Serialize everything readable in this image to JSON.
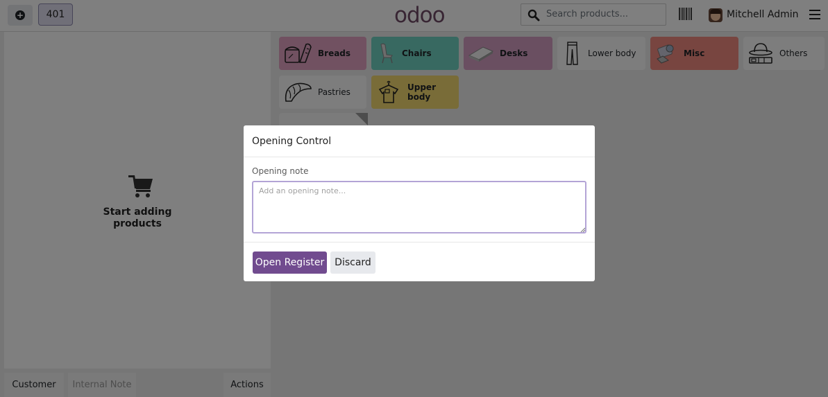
{
  "topbar": {
    "order_number": "401",
    "logo": "odoo",
    "search_placeholder": "Search products...",
    "user_name": "Mitchell Admin"
  },
  "order_panel": {
    "empty_message_line1": "Start adding",
    "empty_message_line2": "products",
    "buttons": {
      "customer": "Customer",
      "internal_note": "Internal Note",
      "actions": "Actions"
    }
  },
  "categories": [
    {
      "label": "Breads",
      "icon": "bread-icon",
      "color": "#e2a2c3"
    },
    {
      "label": "Chairs",
      "icon": "chair-icon",
      "color": "#71d2c2"
    },
    {
      "label": "Desks",
      "icon": "desk-icon",
      "color": "#d49ec2"
    },
    {
      "label": "Lower body",
      "icon": "trousers-icon",
      "color": "#fafafa"
    },
    {
      "label": "Misc",
      "icon": "misc-icon",
      "color": "#f08a80"
    },
    {
      "label": "Others",
      "icon": "hat-icon",
      "color": "#fafafa"
    },
    {
      "label": "Pastries",
      "icon": "croissant-icon",
      "color": "#fafafa"
    },
    {
      "label": "Upper body",
      "icon": "shirt-icon",
      "color": "#f2d870"
    }
  ],
  "modal": {
    "title": "Opening Control",
    "field_label": "Opening note",
    "note_placeholder": "Add an opening note...",
    "note_value": "",
    "open_button": "Open Register",
    "discard_button": "Discard"
  },
  "colors": {
    "brand": "#714b67",
    "primary_button": "#714b8f"
  }
}
